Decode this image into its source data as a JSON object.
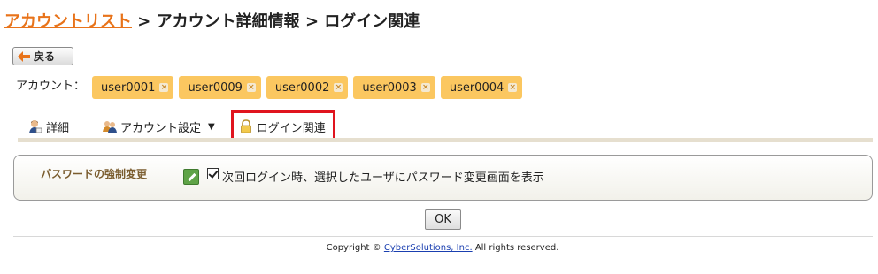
{
  "breadcrumb": {
    "root_link": "アカウントリスト",
    "separator": ">",
    "level2": "アカウント詳細情報",
    "level3": "ログイン関連"
  },
  "toolbar": {
    "back_label": "戻る"
  },
  "accounts": {
    "label": "アカウント：",
    "tags": [
      "user0001",
      "user0009",
      "user0002",
      "user0003",
      "user0004"
    ]
  },
  "tabs": {
    "detail": "詳細",
    "account_settings": "アカウント設定",
    "login": "ログイン関連"
  },
  "form": {
    "password_force_label": "パスワードの強制変更",
    "checkbox_checked": true,
    "checkbox_label": "次回ログイン時、選択したユーザにパスワード変更画面を表示",
    "ok_label": "OK"
  },
  "footer": {
    "copyright_prefix": "Copyright ©",
    "company_link": "CyberSolutions, Inc.",
    "rights": "All rights reserved."
  },
  "colors": {
    "accent_orange": "#e8731a",
    "tag_bg": "#fbc760",
    "highlight_red": "#e0141e",
    "panel_label": "#7a5c2e"
  }
}
